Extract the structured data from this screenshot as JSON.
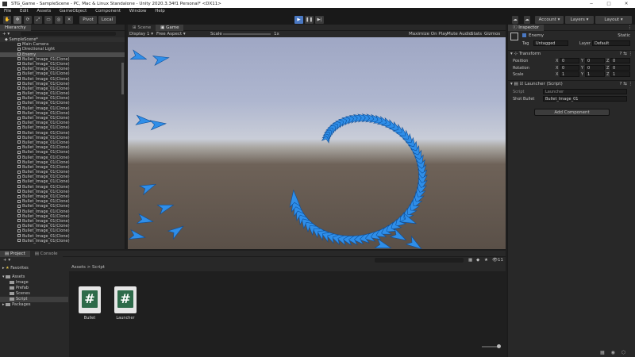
{
  "window": {
    "title": "STG_Game - SampleScene - PC, Mac & Linux Standalone - Unity 2020.3.34f1 Personal* <DX11>"
  },
  "menu": [
    "File",
    "Edit",
    "Assets",
    "GameObject",
    "Component",
    "Window",
    "Help"
  ],
  "toolbar": {
    "pivot": "Pivot",
    "local": "Local",
    "account": "Account",
    "layers": "Layers",
    "layout": "Layout"
  },
  "hierarchy": {
    "tab": "Hierarchy",
    "scene": "SampleScene*",
    "items": [
      "Main Camera",
      "Directional Light",
      "Enemy"
    ],
    "bullet_label": "Bullet_Image_01(Clone)",
    "bullet_count": 38
  },
  "game": {
    "tabs": [
      "Scene",
      "Game"
    ],
    "display": "Display 1",
    "aspect": "Free Aspect",
    "scale_label": "Scale",
    "scale_value": "1x",
    "options": [
      "Maximize On Play",
      "Mute Audio",
      "Stats",
      "Gizmos"
    ]
  },
  "project": {
    "tabs": [
      "Project",
      "Console"
    ],
    "favorites": "Favorites",
    "assets": "Assets",
    "folders": [
      "Image",
      "Prefab",
      "Scenes",
      "Script"
    ],
    "packages": "Packages",
    "breadcrumb": [
      "Assets",
      "Script"
    ],
    "files": [
      "Bullet",
      "Launcher"
    ],
    "search_count": "11"
  },
  "inspector": {
    "tab": "Inspector",
    "static": "Static",
    "object_name": "Enemy",
    "tag_label": "Tag",
    "tag_value": "Untagged",
    "layer_label": "Layer",
    "layer_value": "Default",
    "transform": {
      "title": "Transform",
      "position": {
        "label": "Position",
        "x": "0",
        "y": "0",
        "z": "0"
      },
      "rotation": {
        "label": "Rotation",
        "x": "0",
        "y": "0",
        "z": "0"
      },
      "scale": {
        "label": "Scale",
        "x": "1",
        "y": "1",
        "z": "1"
      }
    },
    "script_comp": {
      "title": "Launcher (Script)",
      "script_label": "Script",
      "script_value": "Launcher",
      "shot_label": "Shot Bullet",
      "shot_value": "Bullet_Image_01"
    },
    "add_component": "Add Component"
  }
}
